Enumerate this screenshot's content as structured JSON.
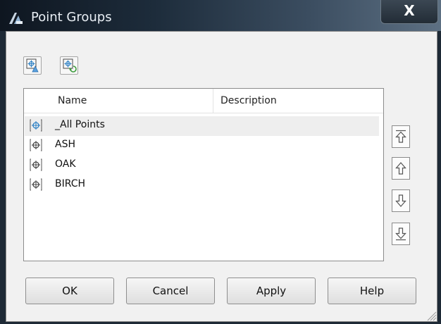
{
  "window": {
    "title": "Point Groups",
    "close_glyph": "X"
  },
  "toolbar": {
    "buttons": [
      {
        "icon": "properties-icon"
      },
      {
        "icon": "refresh-icon"
      }
    ]
  },
  "list": {
    "columns": [
      "Name",
      "Description"
    ],
    "rows": [
      {
        "name": "_All Points",
        "description": "",
        "selected": true
      },
      {
        "name": "ASH",
        "description": ""
      },
      {
        "name": "OAK",
        "description": ""
      },
      {
        "name": "BIRCH",
        "description": ""
      }
    ]
  },
  "side_buttons": [
    "move-to-top-icon",
    "move-up-icon",
    "move-down-icon",
    "move-to-bottom-icon"
  ],
  "buttons": {
    "ok": "OK",
    "cancel": "Cancel",
    "apply": "Apply",
    "help": "Help"
  },
  "colors": {
    "titlebar": "#1d2c3b",
    "icon_blue": "#2a7fc4",
    "client_bg": "#f1f1f1"
  }
}
